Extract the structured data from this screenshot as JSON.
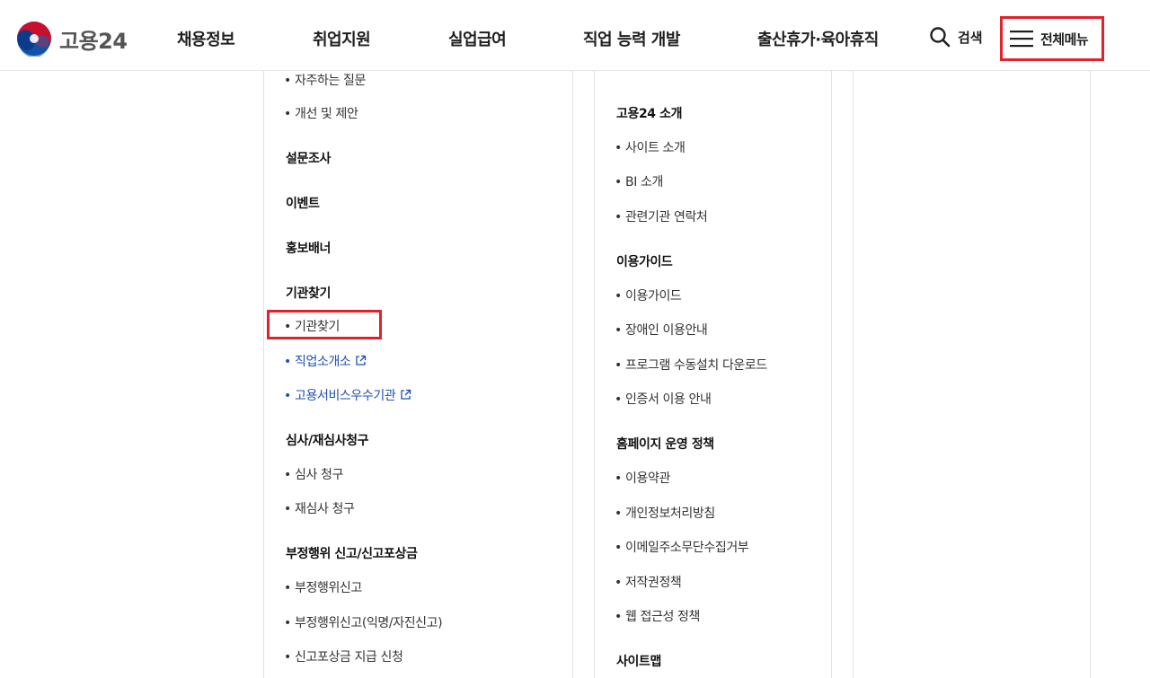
{
  "header": {
    "logo_text": "고용24",
    "nav": [
      "채용정보",
      "취업지원",
      "실업급여",
      "직업 능력 개발",
      "출산휴가·육아휴직"
    ],
    "search_label": "검색",
    "allmenu_label": "전체메뉴"
  },
  "col1": {
    "items": [
      {
        "type": "sub",
        "label": "자주하는 질문"
      },
      {
        "type": "sub",
        "label": "개선 및 제안"
      },
      {
        "type": "heading",
        "label": "설문조사"
      },
      {
        "type": "heading",
        "label": "이벤트"
      },
      {
        "type": "heading",
        "label": "홍보배너"
      },
      {
        "type": "heading",
        "label": "기관찾기"
      },
      {
        "type": "sub",
        "label": "기관찾기"
      },
      {
        "type": "link",
        "label": "직업소개소"
      },
      {
        "type": "link",
        "label": "고용서비스우수기관"
      },
      {
        "type": "heading",
        "label": "심사/재심사청구"
      },
      {
        "type": "sub",
        "label": "심사 청구"
      },
      {
        "type": "sub",
        "label": "재심사 청구"
      },
      {
        "type": "heading",
        "label": "부정행위 신고/신고포상금"
      },
      {
        "type": "sub",
        "label": "부정행위신고"
      },
      {
        "type": "sub",
        "label": "부정행위신고(익명/자진신고)"
      },
      {
        "type": "sub",
        "label": "신고포상금 지급 신청"
      }
    ]
  },
  "col2": {
    "items": [
      {
        "type": "heading",
        "label": "고용24 소개"
      },
      {
        "type": "sub",
        "label": "사이트 소개"
      },
      {
        "type": "sub",
        "label": "BI 소개"
      },
      {
        "type": "sub",
        "label": "관련기관 연락처"
      },
      {
        "type": "heading",
        "label": "이용가이드"
      },
      {
        "type": "sub",
        "label": "이용가이드"
      },
      {
        "type": "sub",
        "label": "장애인 이용안내"
      },
      {
        "type": "sub",
        "label": "프로그램 수동설치 다운로드"
      },
      {
        "type": "sub",
        "label": "인증서 이용 안내"
      },
      {
        "type": "heading",
        "label": "홈페이지 운영 정책"
      },
      {
        "type": "sub",
        "label": "이용약관"
      },
      {
        "type": "sub",
        "label": "개인정보처리방침"
      },
      {
        "type": "sub",
        "label": "이메일주소무단수집거부"
      },
      {
        "type": "sub",
        "label": "저작권정책"
      },
      {
        "type": "sub",
        "label": "웹 접근성 정책"
      },
      {
        "type": "heading",
        "label": "사이트맵"
      }
    ]
  },
  "colors": {
    "highlight": "#e0222a",
    "link": "#1f4fb5",
    "emblem_red": "#c8102e",
    "emblem_blue": "#0b3b8c"
  }
}
